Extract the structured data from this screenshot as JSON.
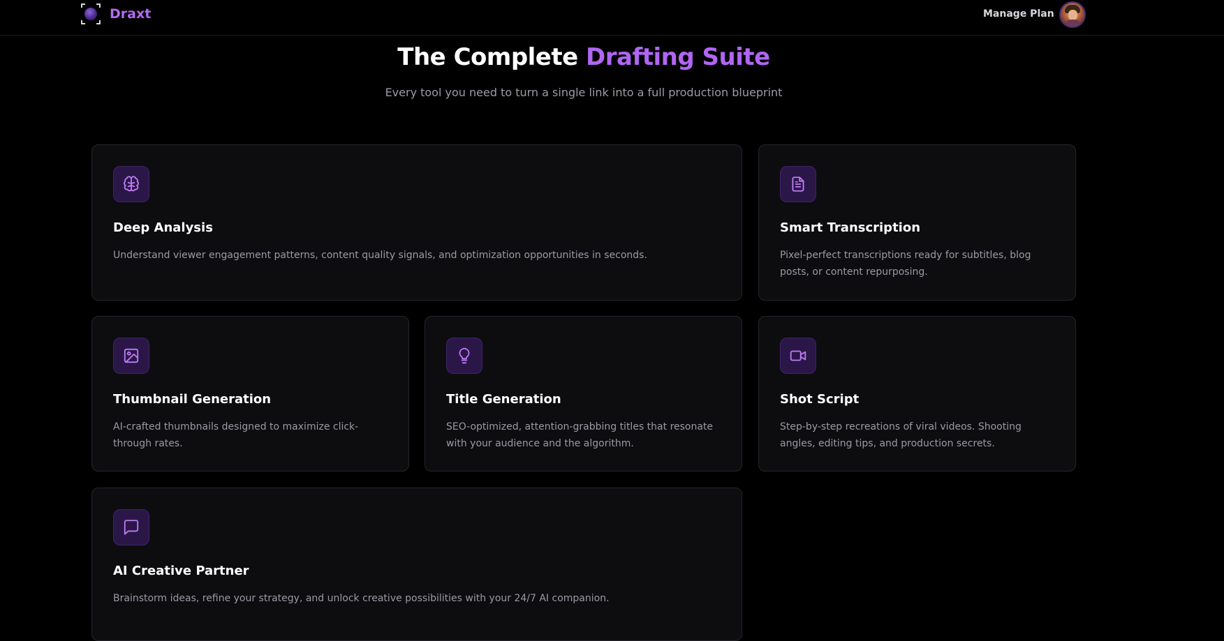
{
  "brand": {
    "name": "Draxt"
  },
  "nav": {
    "manage_plan": "Manage Plan"
  },
  "hero": {
    "title_main": "The Complete",
    "title_accent": "Drafting Suite",
    "subtitle": "Every tool you need to turn a single link into a full production blueprint"
  },
  "colors": {
    "accent": "#b066f2",
    "background": "#000000",
    "card": "#0d0d10",
    "icon_bg": "#2a1748"
  },
  "features": [
    {
      "icon": "brain-icon",
      "title": "Deep Analysis",
      "description": "Understand viewer engagement patterns, content quality signals, and optimization opportunities in seconds."
    },
    {
      "icon": "document-icon",
      "title": "Smart Transcription",
      "description": "Pixel-perfect transcriptions ready for subtitles, blog posts, or content repurposing."
    },
    {
      "icon": "image-icon",
      "title": "Thumbnail Generation",
      "description": "AI-crafted thumbnails designed to maximize click-through rates."
    },
    {
      "icon": "lightbulb-icon",
      "title": "Title Generation",
      "description": "SEO-optimized, attention-grabbing titles that resonate with your audience and the algorithm."
    },
    {
      "icon": "video-camera-icon",
      "title": "Shot Script",
      "description": "Step-by-step recreations of viral videos. Shooting angles, editing tips, and production secrets."
    },
    {
      "icon": "chat-bubble-icon",
      "title": "AI Creative Partner",
      "description": "Brainstorm ideas, refine your strategy, and unlock creative possibilities with your 24/7 AI companion."
    }
  ]
}
